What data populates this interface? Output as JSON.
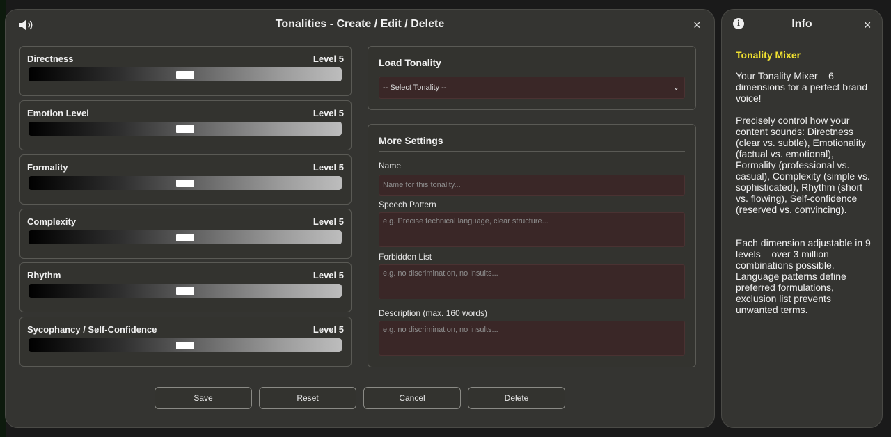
{
  "modal": {
    "title": "Tonalities - Create / Edit / Delete",
    "close": "×"
  },
  "sliders": [
    {
      "label": "Directness",
      "level": "Level 5",
      "value": 5,
      "max": 9
    },
    {
      "label": "Emotion Level",
      "level": "Level 5",
      "value": 5,
      "max": 9
    },
    {
      "label": "Formality",
      "level": "Level 5",
      "value": 5,
      "max": 9
    },
    {
      "label": "Complexity",
      "level": "Level 5",
      "value": 5,
      "max": 9
    },
    {
      "label": "Rhythm",
      "level": "Level 5",
      "value": 5,
      "max": 9
    },
    {
      "label": "Sycophancy / Self-Confidence",
      "level": "Level 5",
      "value": 5,
      "max": 9
    }
  ],
  "load_tonality": {
    "title": "Load Tonality",
    "select_value": "-- Select Tonality --"
  },
  "more_settings": {
    "title": "More Settings",
    "name_label": "Name",
    "name_placeholder": "Name for this tonality...",
    "speech_label": "Speech Pattern",
    "speech_placeholder": "e.g. Precise technical language, clear structure...",
    "forbidden_label": "Forbidden List",
    "forbidden_placeholder": "e.g. no discrimination, no insults...",
    "description_label": "Description (max. 160 words)",
    "description_placeholder": "e.g. no discrimination, no insults..."
  },
  "buttons": {
    "save": "Save",
    "reset": "Reset",
    "cancel": "Cancel",
    "delete": "Delete"
  },
  "info": {
    "icon": "i",
    "title": "Info",
    "close": "×",
    "heading": "Tonality Mixer",
    "para1": "Your Tonality Mixer – 6 dimensions for a perfect brand voice!",
    "para2": "Precisely control how your content sounds: Directness (clear vs. subtle), Emotionality (factual vs. emotional), Formality (professional vs. casual), Complexity (simple vs. sophisticated), Rhythm (short vs. flowing), Self-confidence (reserved vs. convincing).",
    "para3": "Each dimension adjustable in 9 levels – over 3 million combinations possible. Language patterns define preferred formulations, exclusion list prevents unwanted terms."
  },
  "colors": {
    "accent_heading": "#f0e130",
    "input_bg": "#3a2727",
    "panel_bg": "#343431"
  }
}
